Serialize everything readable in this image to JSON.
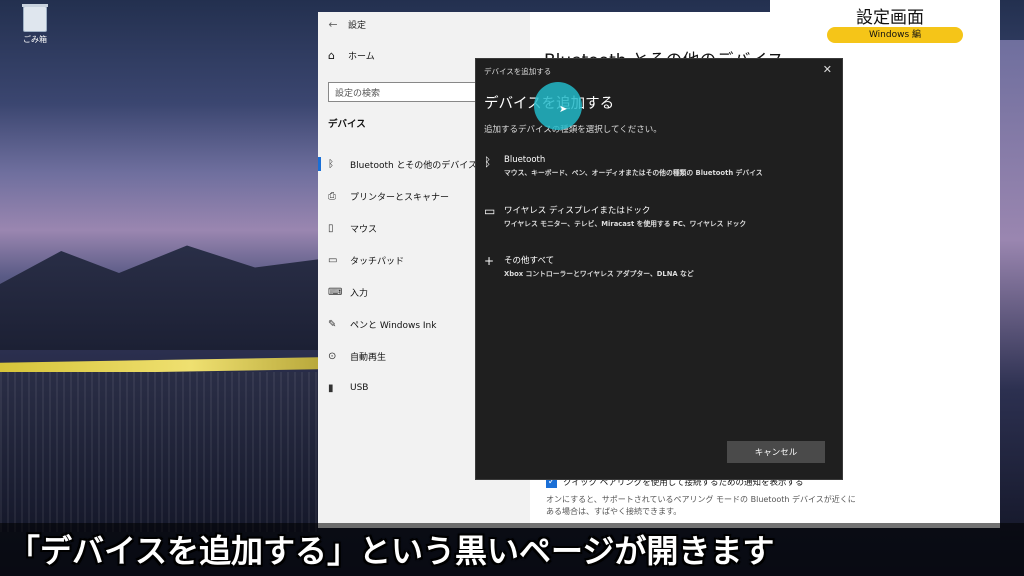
{
  "desktop": {
    "recycle_bin_label": "ごみ箱"
  },
  "settings": {
    "window_title": "設定",
    "home_label": "ホーム",
    "search_placeholder": "設定の検索",
    "section_label": "デバイス",
    "nav_items": [
      {
        "label": "Bluetooth とその他のデバイス",
        "icon": "bluetooth-icon",
        "active": true
      },
      {
        "label": "プリンターとスキャナー",
        "icon": "printer-icon"
      },
      {
        "label": "マウス",
        "icon": "mouse-icon"
      },
      {
        "label": "タッチパッド",
        "icon": "touchpad-icon"
      },
      {
        "label": "入力",
        "icon": "keyboard-icon"
      },
      {
        "label": "ペンと Windows Ink",
        "icon": "pen-icon"
      },
      {
        "label": "自動再生",
        "icon": "autoplay-icon"
      },
      {
        "label": "USB",
        "icon": "usb-icon"
      }
    ],
    "content_title": "Bluetooth とその他のデバイス",
    "quick_pairing_label": "クイック ペアリングを使用して接続するための通知を表示する",
    "quick_pairing_checked": true,
    "quick_pairing_desc": "オンにすると、サポートされているペアリング モードの Bluetooth デバイスが近くにある場合は、すばやく接続できます。"
  },
  "dialog": {
    "title": "デバイスを追加する",
    "heading": "デバイスを追加する",
    "subtitle": "追加するデバイスの種類を選択してください。",
    "options": [
      {
        "name": "Bluetooth",
        "desc": "マウス、キーボード、ペン、オーディオまたはその他の種類の Bluetooth デバイス",
        "icon": "bluetooth-icon"
      },
      {
        "name": "ワイヤレス ディスプレイまたはドック",
        "desc": "ワイヤレス モニター、テレビ、Miracast を使用する PC、ワイヤレス ドック",
        "icon": "monitor-icon"
      },
      {
        "name": "その他すべて",
        "desc": "Xbox コントローラーとワイヤレス アダプター、DLNA など",
        "icon": "plus-icon"
      }
    ],
    "cancel_label": "キャンセル"
  },
  "overlay": {
    "badge_title": "設定画面",
    "badge_tag": "Windows 編",
    "badge_color": "#f5c518",
    "caption": "「デバイスを追加する」という黒いページが開きます"
  }
}
